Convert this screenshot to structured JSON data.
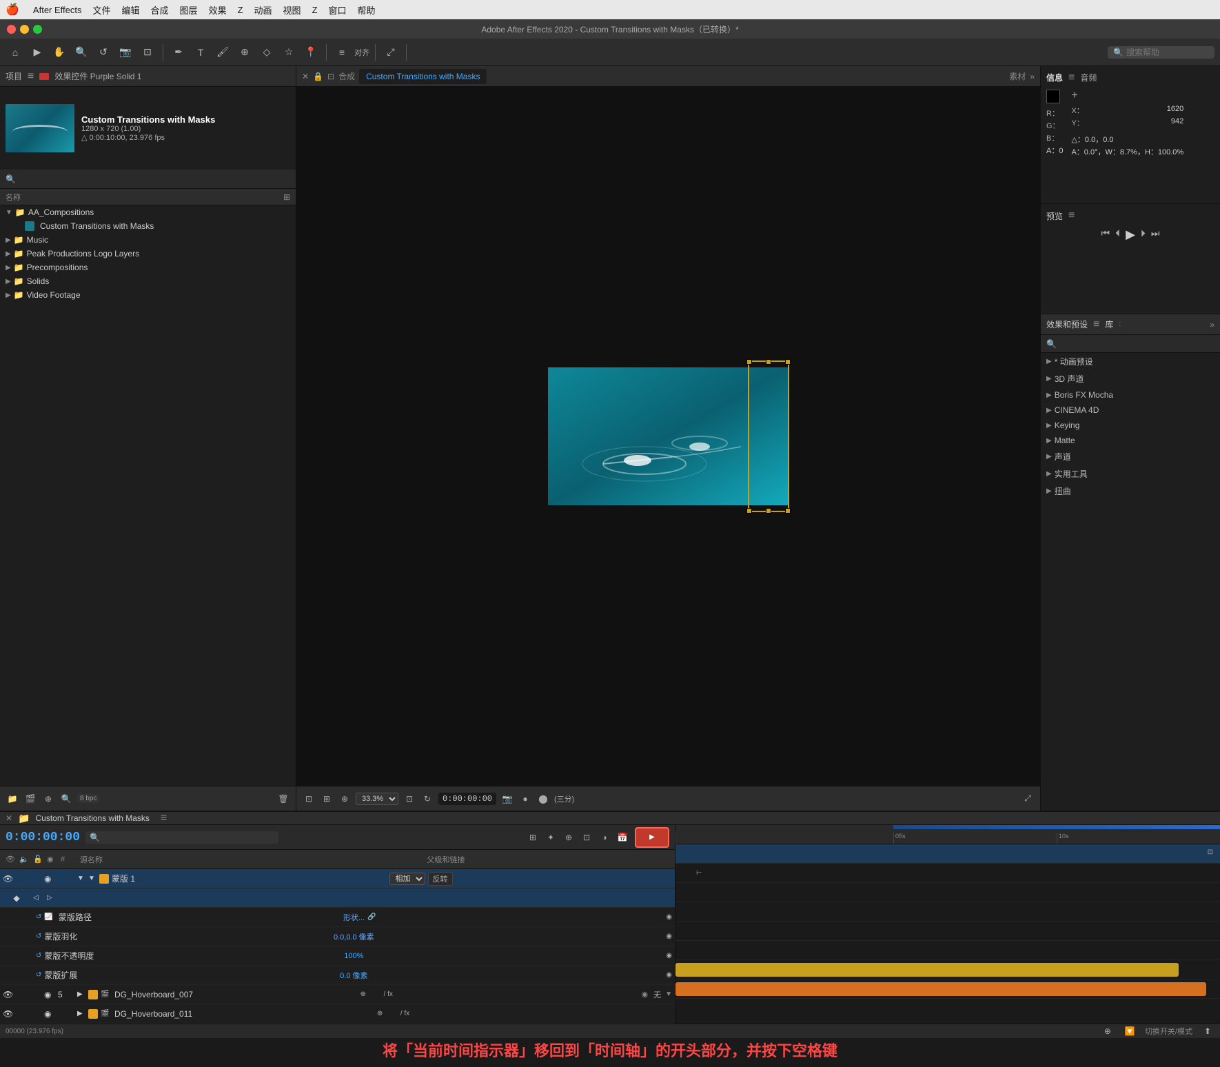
{
  "menubar": {
    "apple": "🍎",
    "items": [
      "After Effects",
      "文件",
      "编辑",
      "合成",
      "图层",
      "效果",
      "Z",
      "动画",
      "视图",
      "Z",
      "窗口",
      "帮助"
    ]
  },
  "titlebar": {
    "text": "Adobe After Effects 2020 - Custom Transitions with Masks（已转换）*"
  },
  "toolbar": {
    "search_placeholder": "搜索帮助"
  },
  "project_panel": {
    "header": "项目",
    "effect_header": "效果控件 Purple Solid 1",
    "comp_thumbnail": {
      "title": "Custom Transitions with Masks",
      "size": "1280 x 720 (1.00)",
      "duration": "△ 0:00:10:00, 23.976 fps"
    },
    "search_placeholder": "🔍",
    "column_header": "名称",
    "tree": [
      {
        "type": "folder",
        "name": "AA_Compositions",
        "expanded": true,
        "icon": "folder"
      },
      {
        "type": "item",
        "name": "Custom Transitions with Masks",
        "selected": true,
        "indent": 1
      },
      {
        "type": "folder",
        "name": "Music",
        "expanded": false,
        "indent": 0
      },
      {
        "type": "folder",
        "name": "Peak Productions Logo Layers",
        "expanded": false,
        "indent": 0
      },
      {
        "type": "folder",
        "name": "Precompositions",
        "expanded": false,
        "indent": 0
      },
      {
        "type": "folder",
        "name": "Solids",
        "expanded": false,
        "indent": 0
      },
      {
        "type": "folder",
        "name": "Video Footage",
        "expanded": false,
        "indent": 0
      }
    ],
    "footer": {
      "bpc": "8 bpc"
    }
  },
  "comp_panel": {
    "header": "合成",
    "comp_name": "Custom Transitions with Masks",
    "tab_label": "Custom Transitions with Masks",
    "素材": "素材",
    "zoom": "33.3%",
    "timecode": "0:00:00:00",
    "three_split": "(三分)"
  },
  "info_panel": {
    "title": "信息",
    "audio_tab": "音频",
    "color": {
      "r": "R：",
      "g": "G：",
      "b": "B：",
      "a": "A：0",
      "r_val": "",
      "g_val": "",
      "b_val": ""
    },
    "coords": {
      "x_label": "X：",
      "x_val": "1620",
      "y_label": "Y：",
      "y_val": "942"
    },
    "delta": "△：0.0，0.0",
    "angle": "A：0.0°，W：8.7%，H：100.0%"
  },
  "preview_panel": {
    "title": "预览",
    "controls": [
      "⏮",
      "◀",
      "▶",
      "▶|",
      "⏭"
    ]
  },
  "effects_panel": {
    "title": "效果和预设",
    "library": "库",
    "search_placeholder": "🔍",
    "items": [
      "* 动画预设",
      "3D 声道",
      "Boris FX Mocha",
      "CINEMA 4D",
      "Keying",
      "Matte",
      "声道",
      "实用工具",
      "扭曲"
    ]
  },
  "timeline_panel": {
    "title": "Custom Transitions with Masks",
    "current_time": "0:00:00:00",
    "fps": "00000 (23.976 fps)",
    "columns": {
      "visibility": "",
      "audio": "",
      "lock": "",
      "label": "",
      "number": "#",
      "name": "源名称",
      "switches": "",
      "mode": "",
      "parent": "父级和链接"
    },
    "layers": [
      {
        "id": "mask_layer",
        "name": "蒙版 1",
        "color": "#e8a020",
        "indent": 1,
        "expanded": true,
        "mode": "相加",
        "reverse": "反转"
      },
      {
        "id": "mask_path",
        "name": "蒙版路径",
        "indent": 2,
        "property": "形状...",
        "is_sub": true
      },
      {
        "id": "mask_feather",
        "name": "蒙版羽化",
        "indent": 2,
        "property": "0.0,0.0 像素",
        "is_sub": true
      },
      {
        "id": "mask_opacity",
        "name": "蒙版不透明度",
        "indent": 2,
        "property": "100%",
        "is_sub": true
      },
      {
        "id": "mask_expand",
        "name": "蒙版扩展",
        "indent": 2,
        "property": "0.0 像素",
        "is_sub": true
      },
      {
        "id": "layer5",
        "number": "5",
        "name": "DG_Hoverboard_007",
        "color": "#e8a020",
        "indent": 1,
        "fx": "/ fx",
        "parent": "无"
      },
      {
        "id": "layer6",
        "number": "",
        "name": "DG_Hoverboard_011",
        "color": "#e8a020",
        "indent": 1,
        "fx": "/ fx"
      }
    ],
    "timeline_labels": {
      "t0": "",
      "t5s": "05s",
      "t10s": "10s"
    },
    "label": "当前时间指示器"
  },
  "instruction_bar": {
    "text": "将「当前时间指示器」移回到「时间轴」的开头部分，并按下空格键"
  }
}
